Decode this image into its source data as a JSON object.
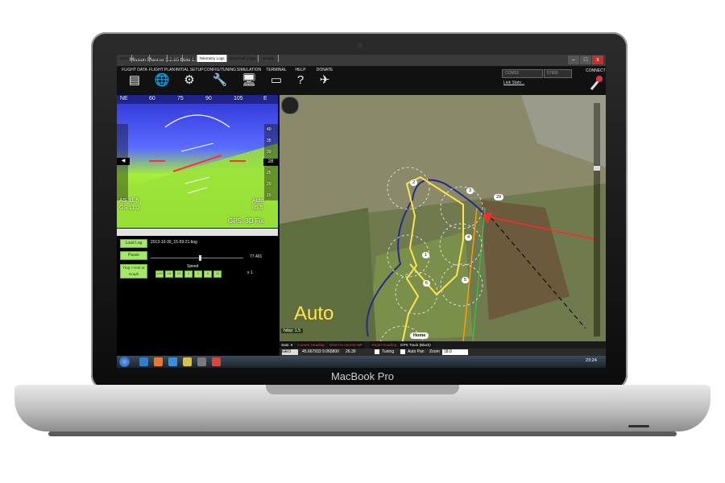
{
  "window": {
    "title": "Mission Planner 1.2.85 build 1.1.5049.16165",
    "controls": [
      "–",
      "□",
      "x"
    ]
  },
  "toolbar": {
    "items": [
      {
        "label": "FLIGHT DATA",
        "icon": "flight-data-icon",
        "glyph": "▤"
      },
      {
        "label": "FLIGHT PLAN",
        "icon": "globe-icon",
        "glyph": "🌐"
      },
      {
        "label": "INITIAL SETUP",
        "icon": "setup-icon",
        "glyph": "⚙"
      },
      {
        "label": "CONFIG/TUNING",
        "icon": "wrench-icon",
        "glyph": "🔧"
      },
      {
        "label": "SIMULATION",
        "icon": "monitor-icon",
        "glyph": "🖥"
      },
      {
        "label": "TERMINAL",
        "icon": "terminal-icon",
        "glyph": "▭"
      },
      {
        "label": "HELP",
        "icon": "help-icon",
        "glyph": "?"
      },
      {
        "label": "DONATE",
        "icon": "donate-icon",
        "glyph": "✈"
      }
    ],
    "port": "COM32",
    "baud": "57600",
    "link_stats": "Link Stats...",
    "connect": "CONNECT"
  },
  "hud": {
    "heading_marks": [
      "NE",
      "60",
      "75",
      "90",
      "105",
      "E"
    ],
    "heading": "28",
    "airspeed_label": "AS 11.5",
    "groundspeed_label": "GS 11.0",
    "mode": "Auto",
    "battery": "85.5",
    "gps": "GPS: 3D Fix",
    "alt_ticks": [
      "40",
      "35",
      "30",
      "25",
      "20",
      "15"
    ]
  },
  "tabs": {
    "items": [
      "Quick",
      "Actions",
      "Gauges",
      "Status",
      "Servo",
      "Telemetry Logs",
      "DataFlash Logs",
      "Scripts"
    ],
    "active": 5
  },
  "telemetry": {
    "load_log": "Load Log",
    "filename": "2013-10-30_15-59-21.tlog",
    "pause": "Pause",
    "progress_value": "77.401",
    "progress_fraction": 0.52,
    "speed_label": "Speed",
    "speed_value": "x 1",
    "tlog_button": "Tlog > Kml or Graph",
    "speed_buttons": [
      "1/10",
      "1/4",
      "1/2",
      "1",
      "2",
      "5",
      "10"
    ]
  },
  "map": {
    "mode_overlay": "Auto",
    "waypoints": [
      "2",
      "3",
      "29",
      "4",
      "1",
      "6",
      "5"
    ],
    "home": "Home",
    "hdop": "hdop: 1.5",
    "sats": "Sats: 9",
    "legend": [
      {
        "label": "Current Heading",
        "color": "#ff3b3b"
      },
      {
        "label": "Direct to current WP",
        "color": "#ff3b3b"
      },
      {
        "label": "Target Heading",
        "color": "#ff3b3b"
      },
      {
        "label": "GPS Track (Black)",
        "color": "#ffffff"
      }
    ]
  },
  "lowerbar": {
    "coord_system": "GEO",
    "coords": "45.667933 9.065800",
    "altitude": "26.39",
    "tuning": "Tuning",
    "auto_pan": "Auto Pan",
    "zoom_label": "Zoom",
    "zoom_value": "18.0"
  },
  "taskbar": {
    "clock": "23:24"
  },
  "laptop": {
    "brand": "MacBook Pro"
  },
  "colors": {
    "accent_green": "#a5e86b",
    "flight_path": "#ffe34d",
    "track": "#2a2a8a"
  }
}
